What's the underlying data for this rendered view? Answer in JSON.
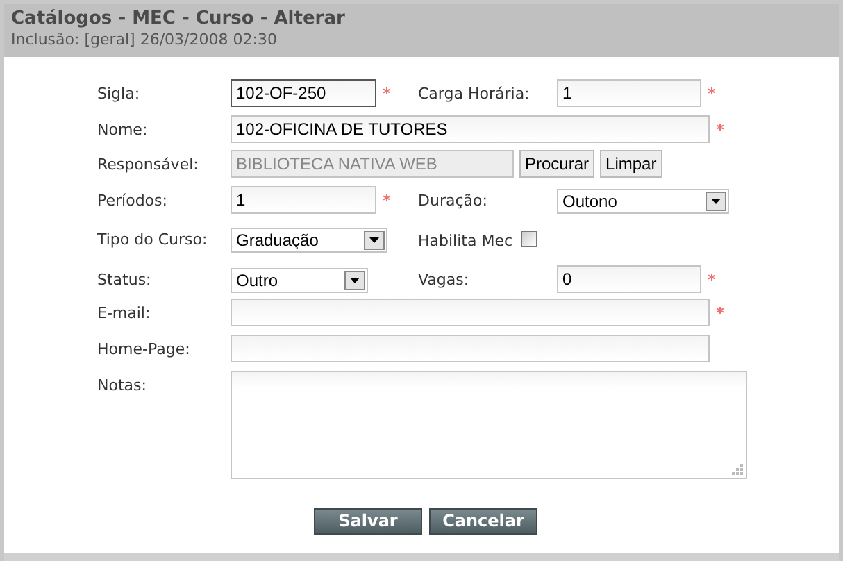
{
  "header": {
    "title": "Catálogos - MEC - Curso - Alterar",
    "subtitle": "Inclusão: [geral] 26/03/2008 02:30"
  },
  "rows": [
    [
      {
        "label": "Sigla:",
        "kind": "text",
        "value": "102-OF-250",
        "required": true,
        "focused": true
      },
      {
        "label": "Carga Horária:",
        "kind": "text",
        "value": "1",
        "required": true
      }
    ],
    [
      {
        "label": "Nome:",
        "kind": "text",
        "value": "102-OFICINA DE TUTORES",
        "required": true
      }
    ],
    [
      {
        "label": "Responsável:",
        "kind": "lookup",
        "value": "BIBLIOTECA NATIVA WEB",
        "disabled": true,
        "buttons": [
          "Procurar",
          "Limpar"
        ]
      }
    ],
    [
      {
        "label": "Períodos:",
        "kind": "text",
        "value": "1",
        "required": true
      },
      {
        "label": "Duração:",
        "kind": "select",
        "value": "Outono"
      }
    ],
    [
      {
        "label": "Tipo do Curso:",
        "kind": "select",
        "value": "Graduação"
      },
      {
        "label": "Habilita Mec",
        "kind": "checkbox",
        "checked": false
      }
    ],
    [
      {
        "label": "Status:",
        "kind": "select",
        "value": "Outro"
      },
      {
        "label": "Vagas:",
        "kind": "text",
        "value": "0",
        "required": true
      }
    ],
    [
      {
        "label": "E-mail:",
        "kind": "text",
        "required": true
      }
    ],
    [
      {
        "label": "Home-Page:",
        "kind": "text"
      }
    ],
    [
      {
        "label": "Notas:",
        "kind": "textarea"
      }
    ]
  ],
  "actions": [
    "Salvar",
    "Cancelar"
  ]
}
